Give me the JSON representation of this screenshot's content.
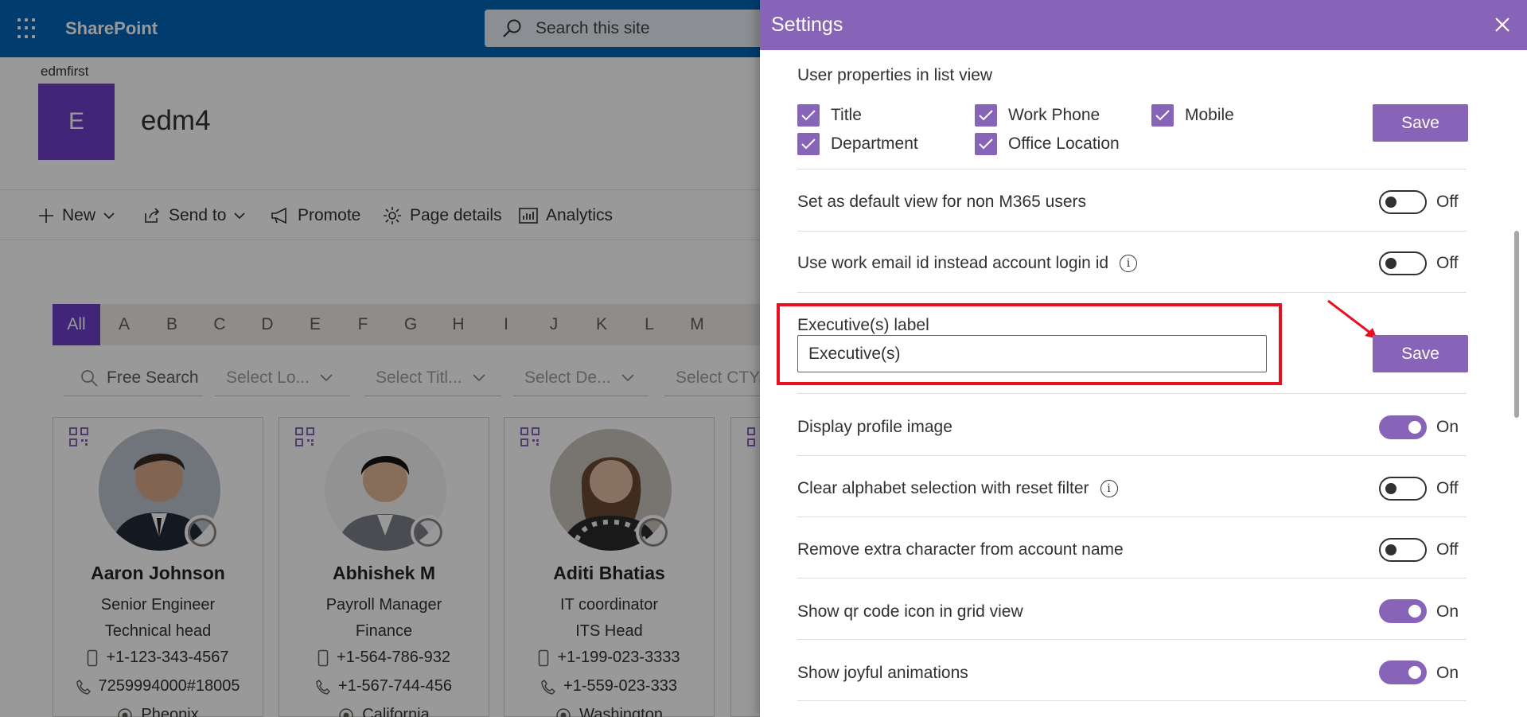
{
  "suitebar": {
    "brand": "SharePoint",
    "search_placeholder": "Search this site"
  },
  "site": {
    "parent": "edmfirst",
    "logo_letter": "E",
    "title": "edm4"
  },
  "commands": [
    {
      "label": "New",
      "icon": "plus-icon"
    },
    {
      "label": "Send to",
      "icon": "share-icon"
    },
    {
      "label": "Promote",
      "icon": "megaphone-icon"
    },
    {
      "label": "Page details",
      "icon": "gear-icon"
    },
    {
      "label": "Analytics",
      "icon": "chart-icon"
    }
  ],
  "alphabet": [
    "All",
    "A",
    "B",
    "C",
    "D",
    "E",
    "F",
    "G",
    "H",
    "I",
    "J",
    "K",
    "L",
    "M"
  ],
  "filters": {
    "search": "Free Search",
    "location": "Select Lo...",
    "title": "Select Titl...",
    "department": "Select De...",
    "city": "Select CTY..."
  },
  "cards": [
    {
      "name": "Aaron Johnson",
      "title": "Senior Engineer",
      "dept": "Technical head",
      "mobile": "+1-123-343-4567",
      "phone": "7259994000#18005",
      "location": "Pheonix"
    },
    {
      "name": "Abhishek M",
      "title": "Payroll Manager",
      "dept": "Finance",
      "mobile": "+1-564-786-932",
      "phone": "+1-567-744-456",
      "location": "California"
    },
    {
      "name": "Aditi Bhatias",
      "title": "IT coordinator",
      "dept": "ITS Head",
      "mobile": "+1-199-023-3333",
      "phone": "+1-559-023-333",
      "location": "Washington"
    }
  ],
  "panel": {
    "title": "Settings",
    "user_props_label": "User properties in list view",
    "checkboxes": [
      "Title",
      "Work Phone",
      "Mobile",
      "Department",
      "Office Location"
    ],
    "save_label": "Save",
    "settings": [
      {
        "label": "Set as default view for non M365 users",
        "state": "Off"
      },
      {
        "label": "Use work email id instead account login id",
        "state": "Off"
      },
      {
        "label": "Display profile image",
        "state": "On"
      },
      {
        "label": "Clear alphabet selection with reset filter",
        "state": "Off"
      },
      {
        "label": "Remove extra character from account name",
        "state": "Off"
      },
      {
        "label": "Show qr code icon in grid view",
        "state": "On"
      },
      {
        "label": "Show joyful animations",
        "state": "On"
      }
    ],
    "exec_label": "Executive(s) label",
    "exec_value": "Executive(s)",
    "info_glyph": "i"
  },
  "colors": {
    "suitebar": "#0364b8",
    "accent": "#8764b8",
    "site_logo": "#6b3fc9",
    "highlight": "#e81123"
  }
}
